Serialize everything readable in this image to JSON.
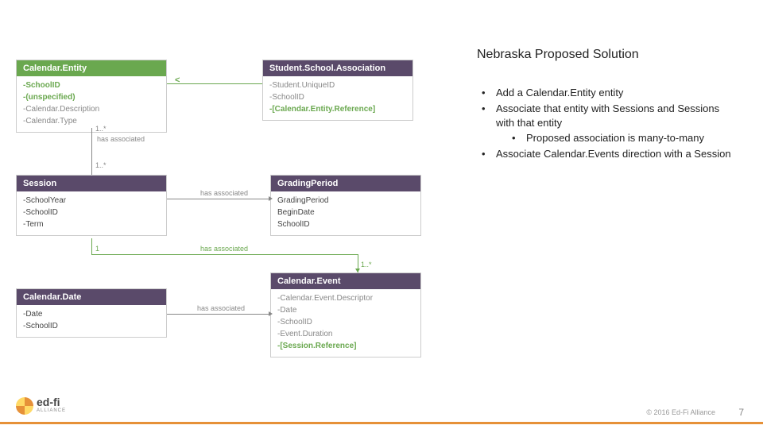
{
  "rhs": {
    "title": "Nebraska Proposed Solution",
    "bullets": [
      "Add a Calendar.Entity entity",
      "Associate that entity with Sessions and Sessions with that entity",
      "Associate Calendar.Events direction with a Session"
    ],
    "sub_bullet": "Proposed association is many-to-many"
  },
  "entities": {
    "calendarEntity": {
      "name": "Calendar.Entity",
      "f1": "-SchoolID",
      "f2": "-(unspecified)",
      "f3": "-Calendar.Description",
      "f4": "-Calendar.Type"
    },
    "ssa": {
      "name": "Student.School.Association",
      "f1": "-Student.UniqueID",
      "f2": "-SchoolID",
      "f3": "-[Calendar.Entity.Reference]"
    },
    "session": {
      "name": "Session",
      "f1": "-SchoolYear",
      "f2": "-SchoolID",
      "f3": "-Term"
    },
    "gradingPeriod": {
      "name": "GradingPeriod",
      "f1": "GradingPeriod",
      "f2": "BeginDate",
      "f3": "SchoolID"
    },
    "calendarDate": {
      "name": "Calendar.Date",
      "f1": "-Date",
      "f2": "-SchoolID"
    },
    "calendarEvent": {
      "name": "Calendar.Event",
      "f1": "-Calendar.Event.Descriptor",
      "f2": "-Date",
      "f3": "-SchoolID",
      "f4": "-Event.Duration",
      "f5": "-[Session.Reference]"
    }
  },
  "labels": {
    "hasAssoc1": "has associated",
    "hasAssoc2": "has associated",
    "hasAssoc3": "has associated",
    "hasAssoc4": "has associated",
    "mult1star_a": "1..*",
    "mult1star_b": "1..*",
    "mult1star_c": "1..*",
    "one": "1"
  },
  "footer": {
    "logo_text": "ed-fi",
    "logo_sub": "ALLIANCE",
    "copyright": "© 2016 Ed-Fi Alliance",
    "page": "7"
  }
}
